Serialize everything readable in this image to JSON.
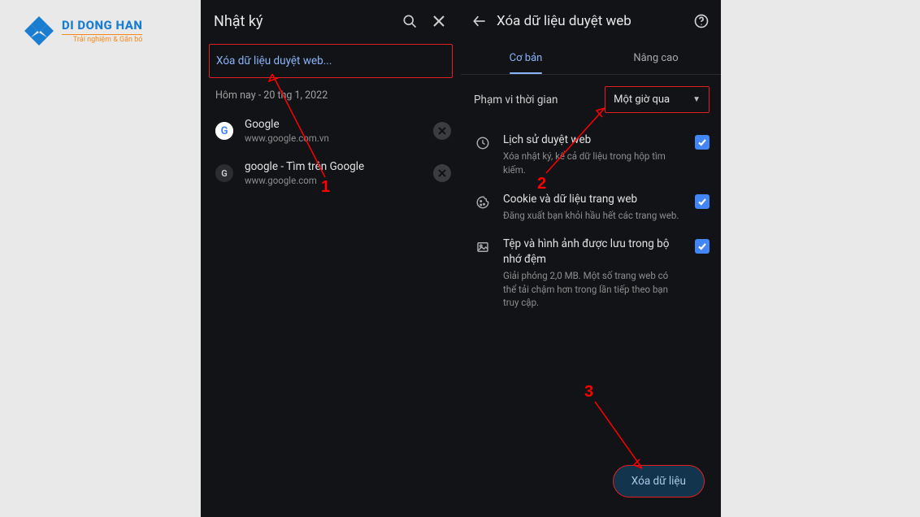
{
  "watermark": {
    "brand": "DI DONG HAN",
    "tagline": "Trải nghiệm & Gắn bó"
  },
  "left": {
    "title": "Nhật ký",
    "clear_link": "Xóa dữ liệu duyệt web...",
    "date": "Hôm nay - 20 thg 1, 2022",
    "items": [
      {
        "title": "Google",
        "url": "www.google.com.vn",
        "favicon": "g-multi",
        "initial": "G"
      },
      {
        "title": "google - Tìm trên Google",
        "url": "www.google.com",
        "favicon": "g-letter",
        "initial": "G"
      }
    ]
  },
  "right": {
    "title": "Xóa dữ liệu duyệt web",
    "tabs": {
      "basic": "Cơ bản",
      "advanced": "Nâng cao"
    },
    "range_label": "Phạm vi thời gian",
    "range_value": "Một giờ qua",
    "options": [
      {
        "icon": "clock",
        "title": "Lịch sử duyệt web",
        "desc": "Xóa nhật ký, kể cả dữ liệu trong hộp tìm kiếm."
      },
      {
        "icon": "cookie",
        "title": "Cookie và dữ liệu trang web",
        "desc": "Đăng xuất bạn khỏi hầu hết các trang web."
      },
      {
        "icon": "image",
        "title": "Tệp và hình ảnh được lưu trong bộ nhớ đệm",
        "desc": "Giải phóng 2,0 MB. Một số trang web có thể tải chậm hơn trong lần tiếp theo bạn truy cập."
      }
    ],
    "clear_button": "Xóa dữ liệu"
  },
  "annotations": {
    "n1": "1",
    "n2": "2",
    "n3": "3"
  }
}
